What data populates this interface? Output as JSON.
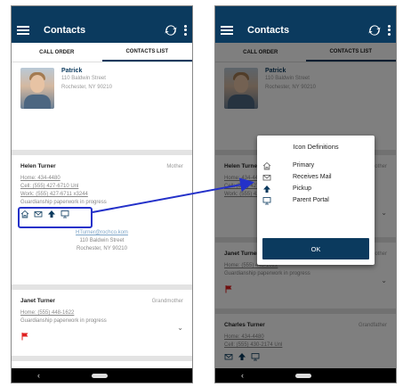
{
  "app": {
    "title": "Contacts"
  },
  "tabs": [
    {
      "label": "CALL ORDER"
    },
    {
      "label": "CONTACTS LIST"
    }
  ],
  "student": {
    "name": "Patrick",
    "address_line1": "110 Baldwin Street",
    "address_line2": "Rochester, NY 90210"
  },
  "contacts": [
    {
      "name": "Helen Turner",
      "relation": "Mother",
      "home": "Home: 434-4480",
      "cell": "Cell: (555) 427-6710 Unl",
      "work": "Work: (555) 427-6711 x3244",
      "note": "Guardianship paperwork in progress",
      "email": "HTurner@rochco.kom",
      "addr1": "110 Baldwin Street",
      "addr2": "Rochester, NY 90210"
    },
    {
      "name": "Janet Turner",
      "relation": "Grandmother",
      "home": "Home: (555) 448-1622",
      "note": "Guardianship paperwork in progress"
    },
    {
      "name": "Charles Turner",
      "relation": "Grandfather",
      "home": "Home: 434-4480",
      "cell": "Cell: (555) 430-2174 Unl"
    }
  ],
  "dialog": {
    "title": "Icon Definitions",
    "items": [
      {
        "icon": "home-icon",
        "label": "Primary"
      },
      {
        "icon": "mail-icon",
        "label": "Receives Mail"
      },
      {
        "icon": "arrow-up-icon",
        "label": "Pickup"
      },
      {
        "icon": "monitor-icon",
        "label": "Parent Portal"
      }
    ],
    "ok_label": "OK"
  },
  "colors": {
    "app_bar": "#0b3a5e",
    "highlight": "#2431c9",
    "flag": "#e02020"
  }
}
